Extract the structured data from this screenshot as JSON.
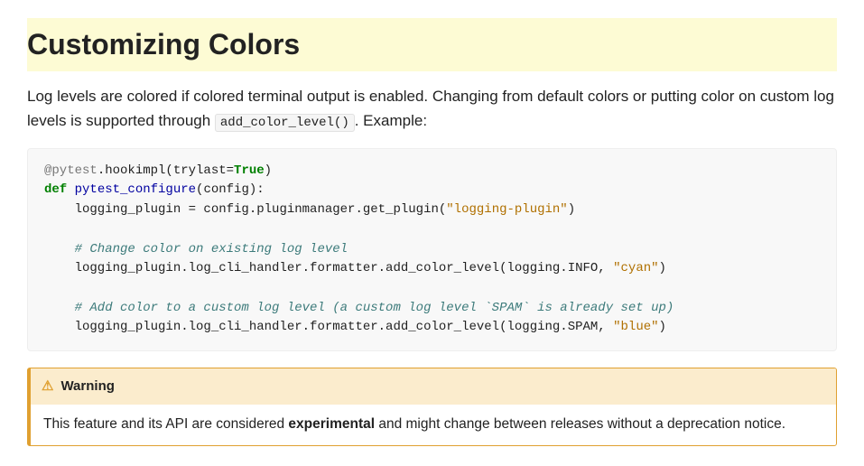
{
  "heading": "Customizing Colors",
  "intro": {
    "part1": "Log levels are colored if colored terminal output is enabled. Changing from default colors or putting color on custom log levels is supported through ",
    "code": "add_color_level()",
    "part2": ". Example:"
  },
  "code": {
    "l1_dec": "@pytest",
    "l1_rest": ".hookimpl(trylast=",
    "l1_true": "True",
    "l1_close": ")",
    "l2_def": "def",
    "l2_fn": " pytest_configure",
    "l2_sig": "(config):",
    "l3": "    logging_plugin = config.pluginmanager.get_plugin(",
    "l3_str": "\"logging-plugin\"",
    "l3_close": ")",
    "l5_cmt": "    # Change color on existing log level",
    "l6": "    logging_plugin.log_cli_handler.formatter.add_color_level(logging.INFO, ",
    "l6_str": "\"cyan\"",
    "l6_close": ")",
    "l8_cmt": "    # Add color to a custom log level (a custom log level `SPAM` is already set up)",
    "l9": "    logging_plugin.log_cli_handler.formatter.add_color_level(logging.SPAM, ",
    "l9_str": "\"blue\"",
    "l9_close": ")"
  },
  "warning": {
    "title": "Warning",
    "body_part1": "This feature and its API are considered ",
    "body_strong": "experimental",
    "body_part2": " and might change between releases without a deprecation notice."
  }
}
